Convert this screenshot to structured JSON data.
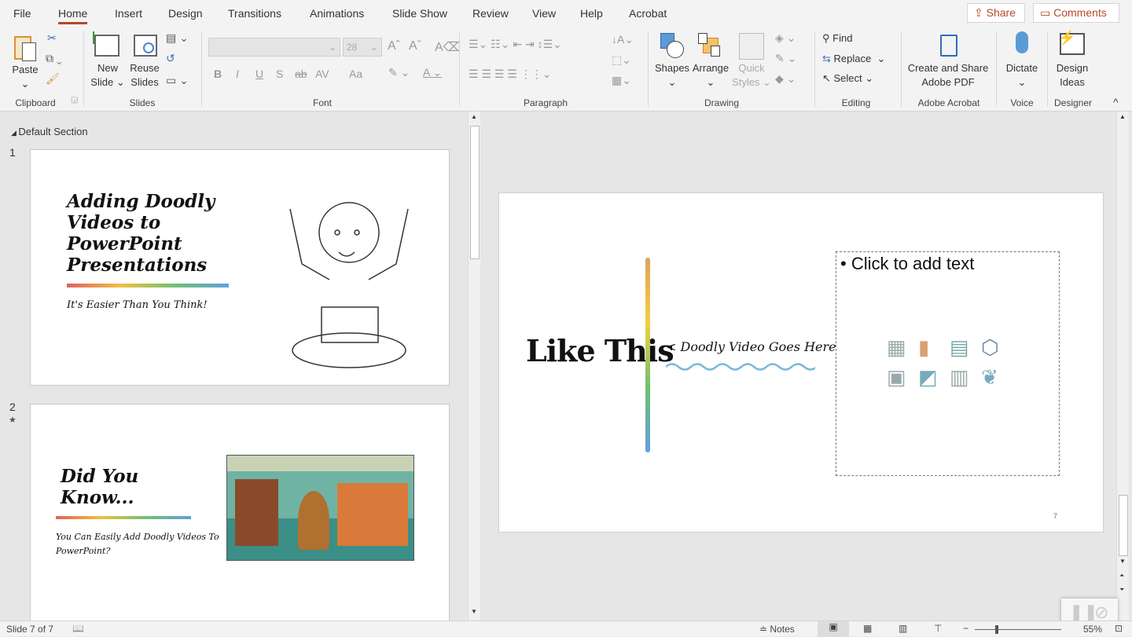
{
  "menu": {
    "items": [
      "File",
      "Home",
      "Insert",
      "Design",
      "Transitions",
      "Animations",
      "Slide Show",
      "Review",
      "View",
      "Help",
      "Acrobat"
    ],
    "active": "Home",
    "share": "Share",
    "comments": "Comments"
  },
  "ribbon": {
    "clipboard": {
      "label": "Clipboard",
      "paste": "Paste"
    },
    "slides": {
      "label": "Slides",
      "new_slide": [
        "New",
        "Slide"
      ],
      "reuse": [
        "Reuse",
        "Slides"
      ]
    },
    "font": {
      "label": "Font",
      "font_name": "",
      "font_size": "28",
      "buttons": [
        "B",
        "I",
        "U",
        "S",
        "ab",
        "AV",
        "Aa"
      ]
    },
    "paragraph": {
      "label": "Paragraph"
    },
    "drawing": {
      "label": "Drawing",
      "shapes": "Shapes",
      "arrange": "Arrange",
      "quick_styles": [
        "Quick",
        "Styles"
      ]
    },
    "editing": {
      "label": "Editing",
      "find": "Find",
      "replace": "Replace",
      "select": "Select"
    },
    "acrobat": {
      "label": "Adobe Acrobat",
      "create": [
        "Create and Share",
        "Adobe PDF"
      ]
    },
    "voice": {
      "label": "Voice",
      "dictate": "Dictate"
    },
    "designer": {
      "label": "Designer",
      "design_ideas": [
        "Design",
        "Ideas"
      ]
    }
  },
  "thumbnails": {
    "section": "Default Section",
    "slides": [
      {
        "number": "1",
        "title": [
          "Adding Doodly",
          "Videos to",
          "PowerPoint",
          "Presentations"
        ],
        "subtitle": "It's Easier Than You Think!"
      },
      {
        "number": "2",
        "title": [
          "Did You",
          "Know..."
        ],
        "subtitle": [
          "You Can Easily Add Doodly Videos To",
          "PowerPoint?"
        ]
      }
    ]
  },
  "slide": {
    "title": "Like This",
    "caption": "< Doodly Video Goes Here",
    "placeholder": "• Click to add text",
    "page_number": "7"
  },
  "status": {
    "slide_info": "Slide 7 of 7",
    "notes": "Notes",
    "zoom": "55%"
  },
  "colors": {
    "accent": "#b7472a"
  }
}
